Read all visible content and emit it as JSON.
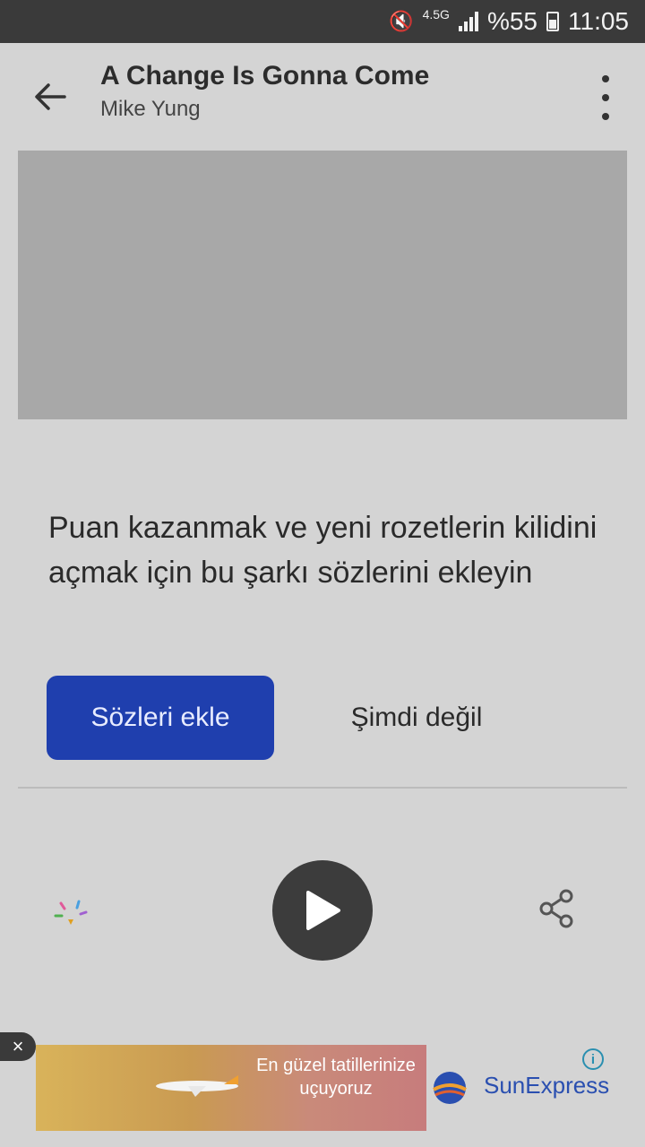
{
  "status_bar": {
    "network": "4.5G",
    "battery": "%55",
    "time": "11:05"
  },
  "header": {
    "title": "A Change Is Gonna Come",
    "artist": "Mike Yung"
  },
  "lyrics_prompt": {
    "message": "Puan kazanmak ve yeni rozetlerin kilidini açmak için bu şarkı sözlerini ekleyin",
    "add_button": "Sözleri ekle",
    "dismiss_button": "Şimdi değil"
  },
  "ad": {
    "text": "En güzel tatillerinize uçuyoruz",
    "brand": "SunExpress",
    "info": "i",
    "close": "×"
  },
  "icons": {
    "back": "arrow-back-icon",
    "more": "more-vert-icon",
    "sparkle": "sparkle-icon",
    "play": "play-icon",
    "share": "share-icon"
  },
  "colors": {
    "primary_button": "#1f3fae",
    "brand": "#2a4fb0"
  }
}
